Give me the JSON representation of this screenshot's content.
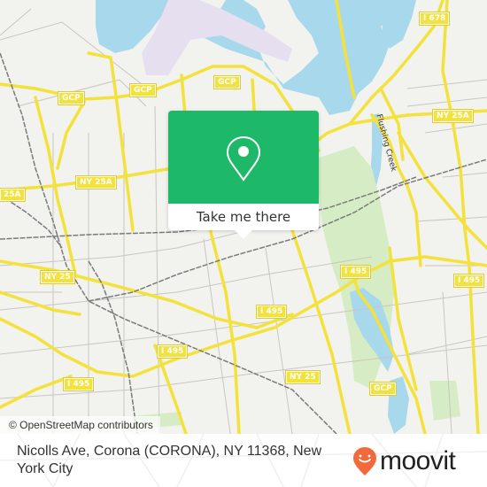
{
  "map": {
    "colors": {
      "land": "#f2f2ee",
      "water": "#a8d8ec",
      "park": "#d6ecc4",
      "road_major": "#f4e23c",
      "road_minor": "#c9c6c0",
      "rail": "#7a7a7a",
      "airport": "#e6dff0"
    },
    "shields": [
      {
        "label": "GCP",
        "name": "shield-gcp-west"
      },
      {
        "label": "GCP",
        "name": "shield-gcp-center"
      },
      {
        "label": "GCP",
        "name": "shield-gcp-east"
      },
      {
        "label": "I 678",
        "name": "shield-i678"
      },
      {
        "label": "NY 25A",
        "name": "shield-ny25a-center"
      },
      {
        "label": "25A",
        "name": "shield-ny25a-west"
      },
      {
        "label": "NY 25A",
        "name": "shield-ny25a-east"
      },
      {
        "label": "NY 25",
        "name": "shield-ny25-west"
      },
      {
        "label": "I 495",
        "name": "shield-i495-park"
      },
      {
        "label": "I 495",
        "name": "shield-i495-east"
      },
      {
        "label": "I 495",
        "name": "shield-i495-center"
      },
      {
        "label": "I 495",
        "name": "shield-i495-mid"
      },
      {
        "label": "I 495",
        "name": "shield-i495-southwest"
      },
      {
        "label": "NY 25",
        "name": "shield-ny25-south"
      },
      {
        "label": "GCP",
        "name": "shield-gcp-south"
      }
    ],
    "street_labels": [
      {
        "label": "Flushing Creek",
        "name": "flushing-creek-label"
      }
    ],
    "attribution": "© OpenStreetMap contributors"
  },
  "popup": {
    "icon": "location-pin-icon",
    "action_label": "Take me there",
    "accent": "#1db868"
  },
  "footer": {
    "address": "Nicolls Ave, Corona (CORONA), NY 11368, New York City",
    "brand": "moovit",
    "brand_color": "#f26a3c"
  }
}
